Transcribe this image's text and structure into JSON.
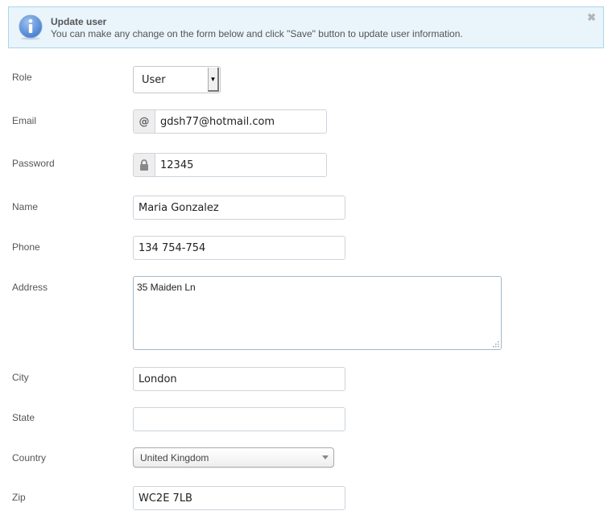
{
  "alert": {
    "icon": "info-icon",
    "title": "Update user",
    "message": "You can make any change on the form below and click \"Save\" button to update user information.",
    "close_icon": "close-icon",
    "close_glyph": "✖"
  },
  "form": {
    "role": {
      "label": "Role",
      "value": "User",
      "arrow": "▼"
    },
    "email": {
      "label": "Email",
      "addon": "@",
      "addon_icon": "at-icon",
      "value": "gdsh77@hotmail.com"
    },
    "password": {
      "label": "Password",
      "addon_icon": "lock-icon",
      "value": "12345"
    },
    "name": {
      "label": "Name",
      "value": "Maria Gonzalez"
    },
    "phone": {
      "label": "Phone",
      "value": "134 754-754"
    },
    "address": {
      "label": "Address",
      "value": "35 Maiden Ln"
    },
    "city": {
      "label": "City",
      "value": "London"
    },
    "state": {
      "label": "State",
      "value": ""
    },
    "country": {
      "label": "Country",
      "value": "United Kingdom"
    },
    "zip": {
      "label": "Zip",
      "value": "WC2E 7LB"
    }
  },
  "colors": {
    "alert_bg": "#e9f4fb",
    "alert_border": "#a8d8ec",
    "info_icon": "#5b8fd6"
  }
}
